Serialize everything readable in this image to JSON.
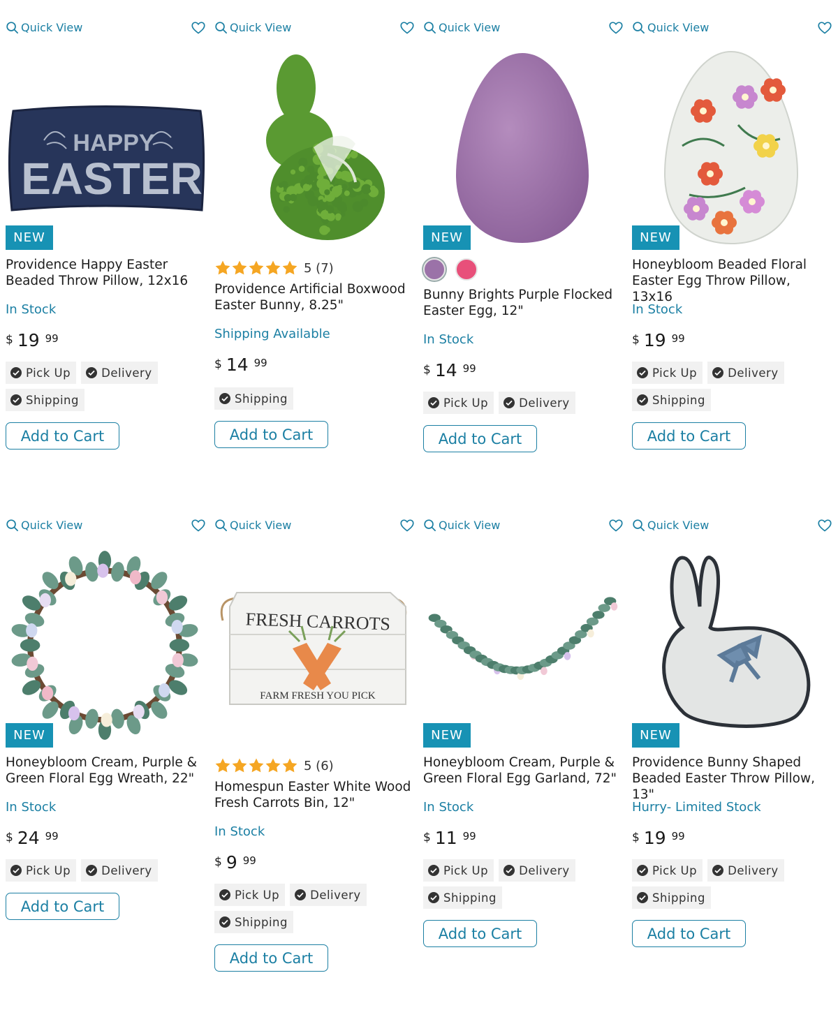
{
  "quick_view_label": "Quick View",
  "add_to_cart_label": "Add to Cart",
  "new_badge_label": "NEW",
  "currency_symbol": "$",
  "colors": {
    "accent": "#1b7fa3",
    "badge": "#1792b4",
    "star": "#f5a623",
    "chip_bg": "#f1f1f1"
  },
  "products": [
    {
      "title": "Providence Happy Easter Beaded Throw Pillow, 12x16",
      "stock": "In Stock",
      "price_dollars": "19",
      "price_cents": "99",
      "badge": "NEW",
      "fulfillment": [
        "Pick Up",
        "Delivery",
        "Shipping"
      ],
      "image": "happy-easter-pillow"
    },
    {
      "title": "Providence Artificial Boxwood Easter Bunny, 8.25\"",
      "rating": 5,
      "rating_text": "5 (7)",
      "stock": "Shipping Available",
      "price_dollars": "14",
      "price_cents": "99",
      "fulfillment": [
        "Shipping"
      ],
      "image": "boxwood-bunny"
    },
    {
      "title": "Bunny Brights Purple Flocked Easter Egg, 12\"",
      "stock": "In Stock",
      "price_dollars": "14",
      "price_cents": "99",
      "badge": "NEW",
      "swatches": [
        "#9b72a8",
        "#e8507a"
      ],
      "fulfillment": [
        "Pick Up",
        "Delivery"
      ],
      "image": "purple-egg"
    },
    {
      "title": "Honeybloom Beaded Floral Easter Egg Throw Pillow, 13x16",
      "stock": "In Stock",
      "price_dollars": "19",
      "price_cents": "99",
      "badge": "NEW",
      "fulfillment": [
        "Pick Up",
        "Delivery",
        "Shipping"
      ],
      "image": "floral-egg-pillow"
    },
    {
      "title": "Honeybloom Cream, Purple & Green Floral Egg Wreath, 22\"",
      "stock": "In Stock",
      "price_dollars": "24",
      "price_cents": "99",
      "badge": "NEW",
      "fulfillment": [
        "Pick Up",
        "Delivery"
      ],
      "image": "egg-wreath"
    },
    {
      "title": "Homespun Easter White Wood Fresh Carrots Bin, 12\"",
      "rating": 5,
      "rating_text": "5 (6)",
      "stock": "In Stock",
      "price_dollars": "9",
      "price_cents": "99",
      "fulfillment": [
        "Pick Up",
        "Delivery",
        "Shipping"
      ],
      "image": "carrots-bin",
      "image_text": {
        "top": "FRESH CARROTS",
        "bottom": "FARM  FRESH  YOU  PICK"
      }
    },
    {
      "title": "Honeybloom Cream, Purple & Green Floral Egg Garland, 72\"",
      "stock": "In Stock",
      "price_dollars": "11",
      "price_cents": "99",
      "badge": "NEW",
      "fulfillment": [
        "Pick Up",
        "Delivery",
        "Shipping"
      ],
      "image": "egg-garland"
    },
    {
      "title": "Providence Bunny Shaped Beaded Easter Throw Pillow, 13\"",
      "stock": "Hurry- Limited Stock",
      "price_dollars": "19",
      "price_cents": "99",
      "badge": "NEW",
      "fulfillment": [
        "Pick Up",
        "Delivery",
        "Shipping"
      ],
      "image": "bunny-pillow"
    }
  ],
  "pillow_text": {
    "line1": "HAPPY",
    "line2": "EASTER"
  }
}
